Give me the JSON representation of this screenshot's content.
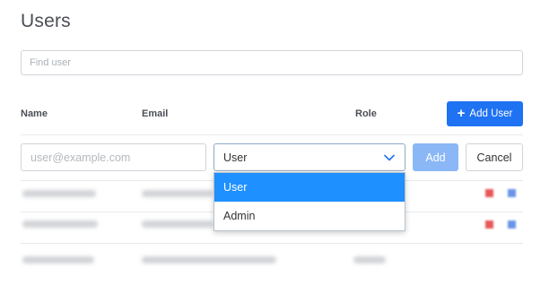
{
  "page": {
    "title": "Users"
  },
  "search": {
    "placeholder": "Find user"
  },
  "table": {
    "headers": {
      "name": "Name",
      "email": "Email",
      "role": "Role"
    },
    "add_user_label": "Add User"
  },
  "new_user_row": {
    "email_placeholder": "user@example.com",
    "role_value": "User",
    "add_label": "Add",
    "cancel_label": "Cancel"
  },
  "role_dropdown": {
    "options": [
      "User",
      "Admin"
    ],
    "selected": "User"
  },
  "icons": {
    "add_user": "plus-icon",
    "select": "chevron-down-icon",
    "row_delete": "delete-icon",
    "row_edit": "edit-icon"
  },
  "colors": {
    "primary": "#1f72f2",
    "primary_disabled": "#8bb7f7",
    "dropdown_selected": "#1e90ff",
    "delete": "#e85858",
    "edit": "#6a93e8"
  }
}
